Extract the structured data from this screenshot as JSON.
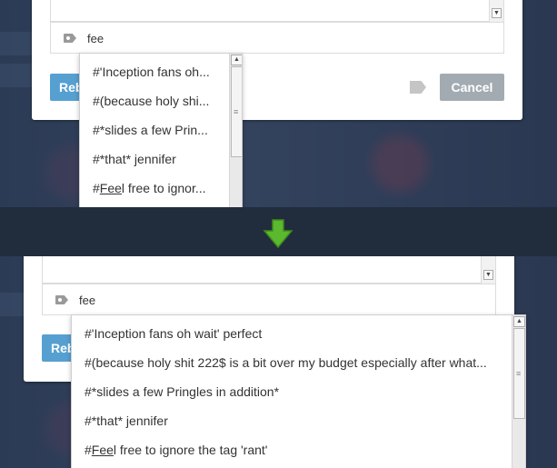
{
  "composer": {
    "tag_input_value": "fee",
    "reblog_label": "Reblog",
    "cancel_label": "Cancel"
  },
  "tag_suggestions": [
    {
      "prefix": "#",
      "match": "Fee",
      "text": "'Inception fans oh wait' perfect"
    },
    {
      "prefix": "#",
      "match": "",
      "text": "(because holy shit 222$ is a bit over my budget especially after what..."
    },
    {
      "prefix": "#",
      "match": "",
      "text": "*slides a few Pringles in addition*"
    },
    {
      "prefix": "#",
      "match": "",
      "text": "*that* jennifer"
    },
    {
      "prefix": "#",
      "match": "Fee",
      "text": "l free to ignore the tag 'rant'"
    }
  ],
  "top_truncated": [
    "#'Inception fans oh...",
    "#(because holy shi...",
    "#*slides a few Prin...",
    "#*that* jennifer",
    "l free to ignor..."
  ],
  "colors": {
    "reblog_button": "#56a0d1",
    "cancel_button": "#a3abb2",
    "divider": "#212c3d",
    "arrow": "#5cb82e"
  },
  "icons": {
    "tag": "tag-icon",
    "post": "post-tag-icon",
    "arrow": "arrow-down-icon"
  }
}
